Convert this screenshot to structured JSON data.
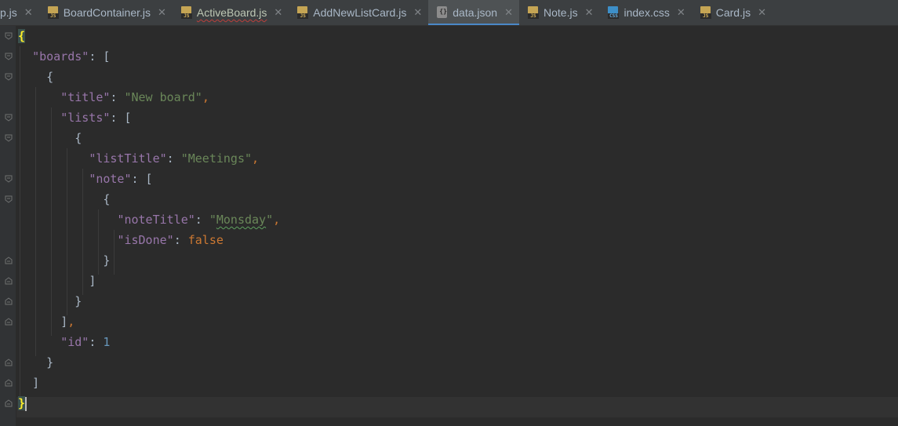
{
  "tabs": [
    {
      "name": "p.js",
      "icon": "js",
      "active": false,
      "squiggle": false,
      "close": "✕"
    },
    {
      "name": "BoardContainer.js",
      "icon": "js",
      "active": false,
      "squiggle": false,
      "close": "✕"
    },
    {
      "name": "ActiveBoard.js",
      "icon": "js",
      "active": false,
      "squiggle": true,
      "close": "✕"
    },
    {
      "name": "AddNewListCard.js",
      "icon": "js",
      "active": false,
      "squiggle": false,
      "close": "✕"
    },
    {
      "name": "data.json",
      "icon": "json",
      "active": true,
      "squiggle": false,
      "close": "✕"
    },
    {
      "name": "Note.js",
      "icon": "js",
      "active": false,
      "squiggle": false,
      "close": "✕"
    },
    {
      "name": "index.css",
      "icon": "css",
      "active": false,
      "squiggle": false,
      "close": "✕"
    },
    {
      "name": "Card.js",
      "icon": "js",
      "active": false,
      "squiggle": false,
      "close": "✕"
    }
  ],
  "icon_labels": {
    "js": "JS",
    "css": "CSS",
    "json": "{}"
  },
  "code": {
    "boards_key": "\"boards\"",
    "title_key": "\"title\"",
    "title_val": "\"New board\"",
    "lists_key": "\"lists\"",
    "listTitle_key": "\"listTitle\"",
    "listTitle_val": "\"Meetings\"",
    "note_key": "\"note\"",
    "noteTitle_key": "\"noteTitle\"",
    "noteTitle_val_open": "\"",
    "noteTitle_val_word": "Monsday",
    "noteTitle_val_close": "\"",
    "isDone_key": "\"isDone\"",
    "isDone_val": "false",
    "id_key": "\"id\"",
    "id_val": "1"
  },
  "colors": {
    "background": "#2b2b2b",
    "key": "#9876aa",
    "string": "#6a8759",
    "number": "#6897bb",
    "keyword": "#cc7832",
    "active_tab_underline": "#4a88c7"
  }
}
